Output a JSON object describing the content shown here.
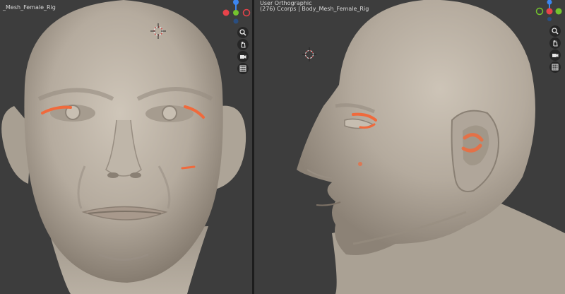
{
  "viewport_left": {
    "object_label": "_Mesh_Female_Rig"
  },
  "viewport_right": {
    "view_label": "User Orthographic",
    "object_label": "(276) Ccorps | Body_Mesh_Female_Rig"
  },
  "colors": {
    "viewport_bg": "#3d3d3d",
    "skin": "#bdb4a7",
    "skin_shadow": "#8f8578",
    "mask_orange": "#f06a3c",
    "axis_x": "#e8434a",
    "axis_y": "#74c32e",
    "axis_z": "#3c86f0"
  },
  "nav_icons": [
    "zoom-icon",
    "hand-pan-icon",
    "camera-icon",
    "grid-icon"
  ]
}
